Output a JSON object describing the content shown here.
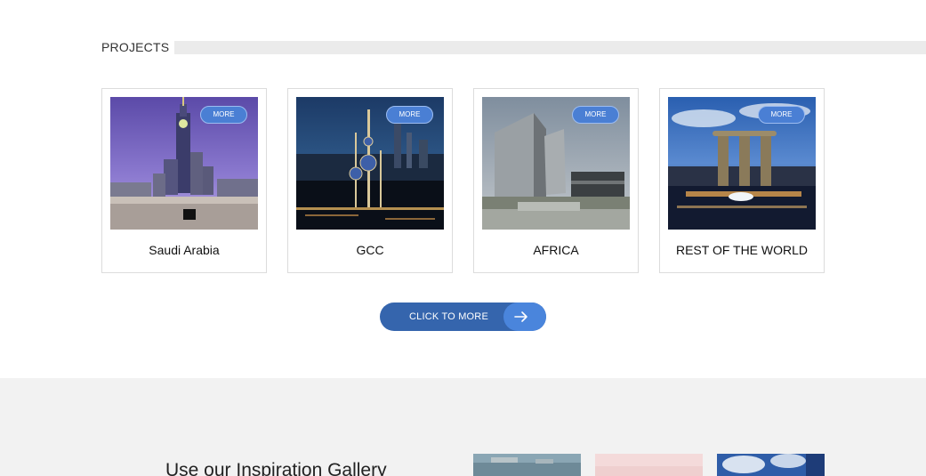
{
  "projects": {
    "title": "PROJECTS",
    "more_label": "MORE",
    "cards": [
      {
        "label": "Saudi Arabia",
        "image": "mecca-clock-tower-photo"
      },
      {
        "label": "GCC",
        "image": "kuwait-towers-night-photo"
      },
      {
        "label": "AFRICA",
        "image": "modern-glass-building-photo"
      },
      {
        "label": "REST OF THE WORLD",
        "image": "marina-bay-sands-photo"
      }
    ],
    "cta_label": "CLICK TO MORE",
    "cta_icon": "arrow-right-icon"
  },
  "gallery": {
    "heading": "Use our Inspiration Gallery",
    "thumbs": [
      "coastal-city-photo",
      "pink-interior-photo",
      "blue-sky-building-photo"
    ]
  },
  "colors": {
    "accent": "#3565ad",
    "accent_light": "#4a85dc",
    "band": "#f2f2f2",
    "rule": "#ebebeb"
  }
}
